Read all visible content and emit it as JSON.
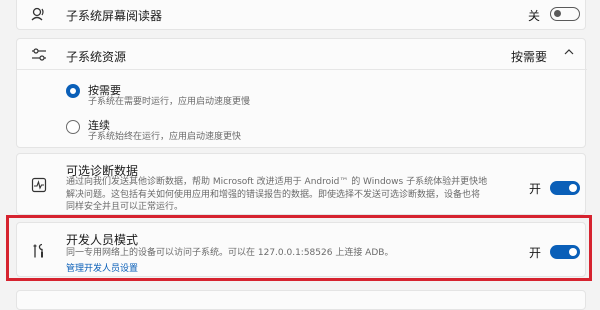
{
  "screen_reader": {
    "title": "子系统屏幕阅读器",
    "toggle_label": "关"
  },
  "resources": {
    "title": "子系统资源",
    "value": "按需要",
    "options": [
      {
        "label": "按需要",
        "desc": "子系统在需要时运行，应用启动速度更慢",
        "checked": true
      },
      {
        "label": "连续",
        "desc": "子系统始终在运行，应用启动速度更快",
        "checked": false
      }
    ]
  },
  "diagnostics": {
    "title": "可选诊断数据",
    "desc_lines": [
      "通过向我们发送其他诊断数据，帮助 Microsoft 改进适用于 Android™ 的 Windows 子系统体验并更快地",
      "解决问题。这包括有关如何使用应用和增强的错误报告的数据。即使选择不发送可选诊断数据，设备也将",
      "同样安全并且可以正常运行。"
    ],
    "toggle_label": "开"
  },
  "developer": {
    "title": "开发人员模式",
    "desc": "同一专用网络上的设备可以访问子系统。可以在 127.0.0.1:58526 上连接 ADB。",
    "link": "管理开发人员设置",
    "toggle_label": "开"
  },
  "colors": {
    "accent": "#0a5fb8",
    "highlight": "#d6232f"
  }
}
